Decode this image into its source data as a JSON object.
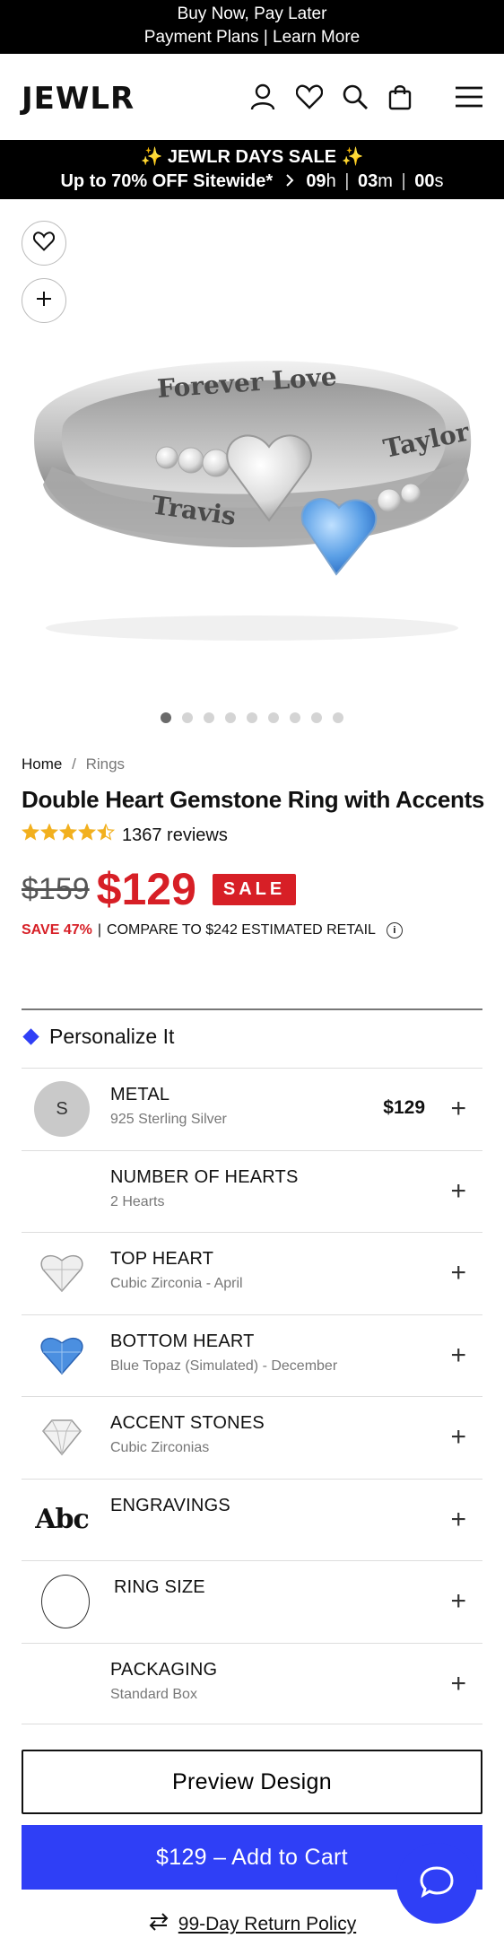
{
  "promo_top": {
    "line1": "Buy Now, Pay Later",
    "line2": "Payment Plans | Learn More"
  },
  "header": {
    "logo": "JEWLR",
    "icons": [
      "account-icon",
      "heart-icon",
      "search-icon",
      "bag-icon",
      "menu-icon"
    ]
  },
  "sale_bar": {
    "headline": "✨ JEWLR DAYS SALE ✨",
    "subline": "Up to 70% OFF Sitewide*",
    "countdown": {
      "hours": "09",
      "hours_unit": "h",
      "minutes": "03",
      "minutes_unit": "m",
      "seconds": "00",
      "seconds_unit": "s"
    }
  },
  "image_actions": [
    "favorite-heart-icon",
    "add-plus-icon"
  ],
  "product_image": {
    "engravings": {
      "band_top": "Forever Love",
      "left": "Travis",
      "right": "Taylor"
    }
  },
  "carousel": {
    "count": 9,
    "active_index": 0
  },
  "breadcrumb": {
    "home": "Home",
    "separator": "/",
    "current": "Rings"
  },
  "product": {
    "title": "Double Heart Gemstone Ring with Accents",
    "rating": 4.5,
    "reviews": "1367 reviews",
    "old_price": "$159",
    "new_price": "$129",
    "sale_badge": "SALE",
    "save_pct": "SAVE 47%",
    "compare_text": "COMPARE TO $242 ESTIMATED RETAIL",
    "info_symbol": "i"
  },
  "personalize": {
    "heading": "Personalize It",
    "options": [
      {
        "name": "METAL",
        "value": "925 Sterling Silver",
        "price": "$129",
        "thumb": "metal-swatch",
        "thumb_label": "S"
      },
      {
        "name": "NUMBER OF HEARTS",
        "value": "2 Hearts",
        "price": "",
        "thumb": "none"
      },
      {
        "name": "TOP HEART",
        "value": "Cubic Zirconia - April",
        "price": "",
        "thumb": "clear-heart-gem"
      },
      {
        "name": "BOTTOM HEART",
        "value": "Blue Topaz (Simulated) - December",
        "price": "",
        "thumb": "blue-heart-gem"
      },
      {
        "name": "ACCENT STONES",
        "value": "Cubic Zirconias",
        "price": "",
        "thumb": "round-diamond"
      },
      {
        "name": "ENGRAVINGS",
        "value": "",
        "price": "",
        "thumb": "abc-text",
        "thumb_label": "Abc"
      },
      {
        "name": "RING SIZE",
        "value": "",
        "price": "",
        "thumb": "ring-size-circle"
      },
      {
        "name": "PACKAGING",
        "value": "Standard Box",
        "price": "",
        "thumb": "none"
      }
    ],
    "plus_symbol": "+"
  },
  "buttons": {
    "preview": "Preview Design",
    "add_to_cart": "$129 – Add to Cart",
    "return_policy": "99-Day Return Policy"
  },
  "colors": {
    "accent_blue": "#2f3ff6",
    "sale_red": "#d71f26",
    "star_gold": "#f2b01e"
  }
}
